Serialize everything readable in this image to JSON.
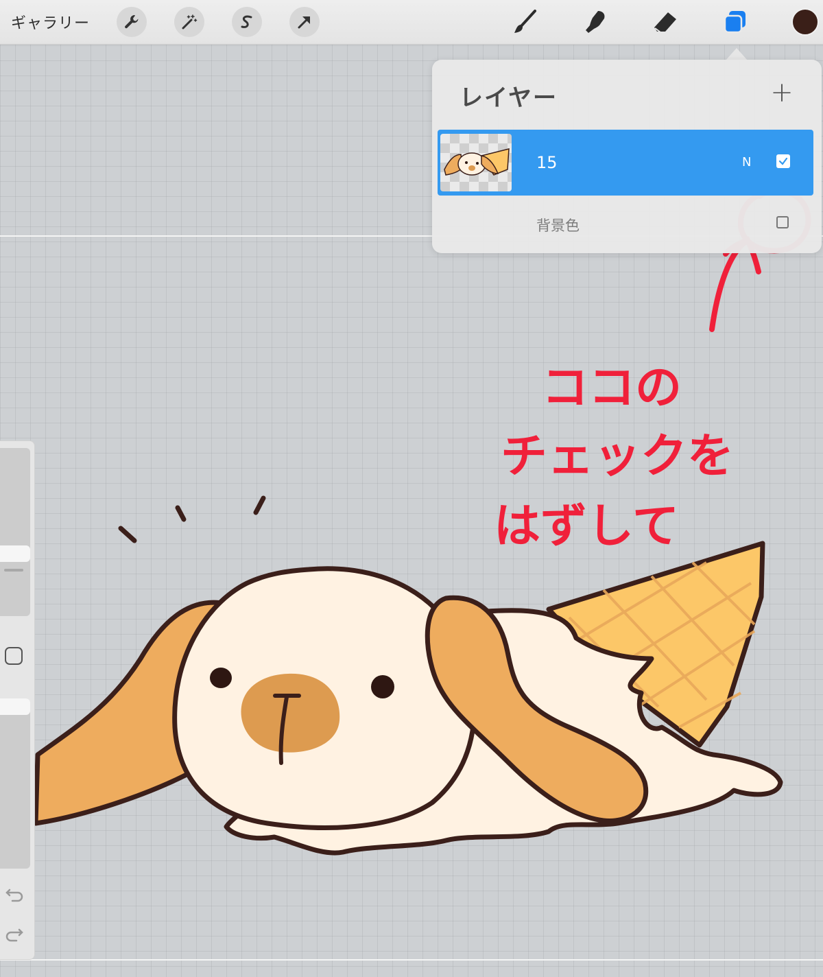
{
  "toolbar": {
    "gallery_label": "ギャラリー",
    "left_tools": [
      "wrench-icon",
      "magic-wand-icon",
      "selection-s-icon",
      "transform-arrow-icon"
    ],
    "right_tools": [
      "brush-icon",
      "smudge-icon",
      "eraser-icon",
      "layers-icon"
    ],
    "active_tool": "layers-icon",
    "accent_color": "#1a7ff0",
    "current_color": "#3a1f18"
  },
  "layers_panel": {
    "title": "レイヤー",
    "add_label": "+",
    "layers": [
      {
        "name": "15",
        "blend_mode": "N",
        "visible": true,
        "selected": true
      }
    ],
    "background_color": {
      "label": "背景色",
      "visible": false
    }
  },
  "sidebar": {
    "icons": [
      "square-modifier-icon",
      "undo-icon",
      "redo-icon"
    ]
  },
  "annotation": {
    "lines": [
      "ココの",
      "チェックを",
      "はずして"
    ],
    "color": "#f0203a"
  }
}
